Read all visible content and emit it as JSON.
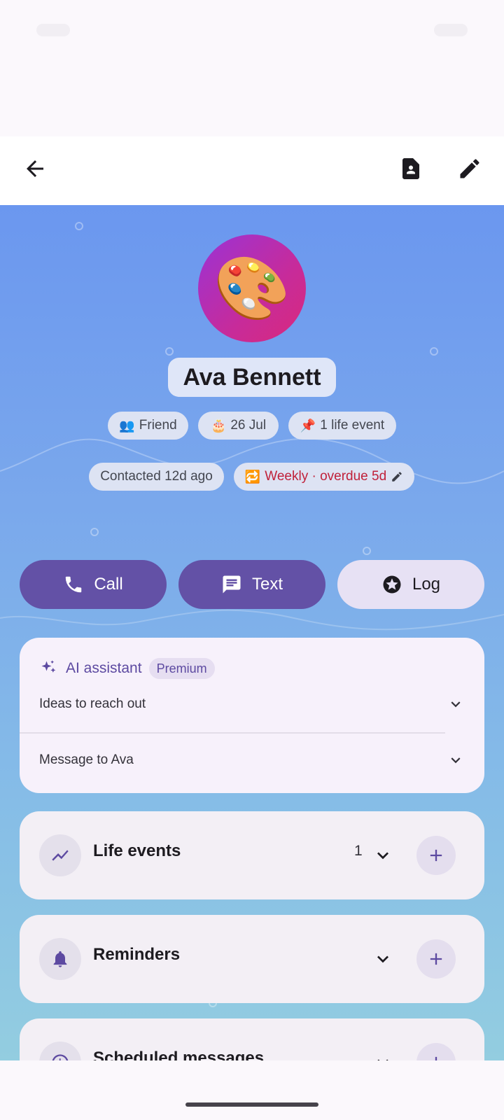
{
  "toolbar": {
    "back_icon": "arrow-back-icon",
    "contact_card_icon": "contact-card-icon",
    "edit_icon": "edit-pencil-icon"
  },
  "profile": {
    "avatar_emoji": "🎨",
    "name": "Ava Bennett",
    "tags": [
      {
        "emoji": "👥",
        "label": "Friend"
      },
      {
        "emoji": "🎂",
        "label": "26 Jul"
      },
      {
        "emoji": "📌",
        "label": "1 life event"
      }
    ],
    "contacted": "Contacted 12d ago",
    "cadence": {
      "emoji": "🔁",
      "label": "Weekly · overdue 5d",
      "color": "#c0213a"
    }
  },
  "actions": {
    "call": "Call",
    "text": "Text",
    "log": "Log"
  },
  "ai_assistant": {
    "title": "AI assistant",
    "badge": "Premium",
    "rows": [
      {
        "label": "Ideas to reach out"
      },
      {
        "label": "Message to Ava"
      }
    ]
  },
  "sections": [
    {
      "title": "Life events",
      "count": "1",
      "icon": "trending-up-icon"
    },
    {
      "title": "Reminders",
      "count": "",
      "icon": "bell-icon"
    },
    {
      "title": "Scheduled messages",
      "count": "",
      "icon": "schedule-icon"
    }
  ],
  "colors": {
    "accent": "#6351a6",
    "accent_text": "#5d4aa1",
    "hero_top": "#6b97ef",
    "hero_bottom": "#93cde0"
  }
}
